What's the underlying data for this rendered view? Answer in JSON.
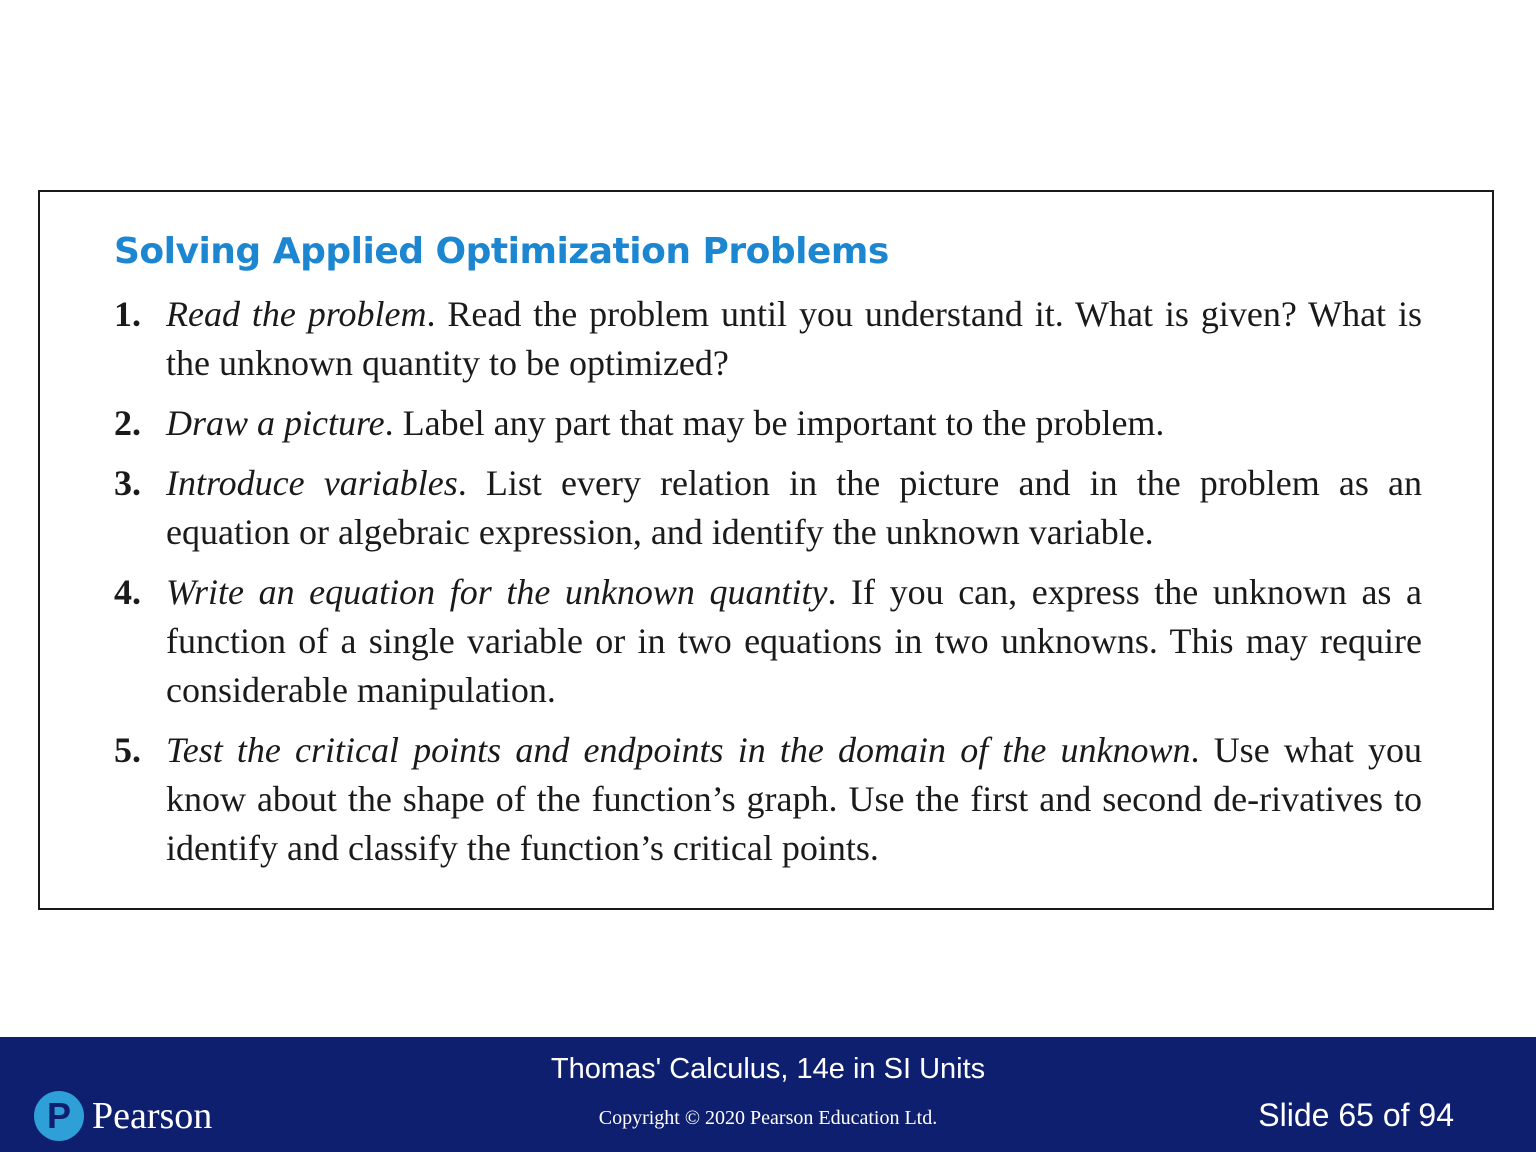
{
  "box": {
    "title": "Solving Applied Optimization Problems",
    "steps": [
      {
        "number": "1.",
        "lead": "Read the problem",
        "text": ". Read the problem until you understand it. What is given? What is the unknown quantity to be optimized?"
      },
      {
        "number": "2.",
        "lead": "Draw a picture",
        "text": ". Label any part that may be important to the problem."
      },
      {
        "number": "3.",
        "lead": "Introduce variables",
        "text": ". List every relation in the picture and in the problem as an equation or algebraic expression, and identify the unknown variable."
      },
      {
        "number": "4.",
        "lead": "Write an equation for the unknown quantity",
        "text": ". If you can, express the unknown as a function of a single variable or in two equations in two unknowns. This may require considerable manipulation."
      },
      {
        "number": "5.",
        "lead": "Test the critical points and endpoints in the domain of the unknown",
        "text": ". Use what you know about the shape of the function’s graph. Use the first and second de-rivatives to identify and classify the function’s critical points."
      }
    ]
  },
  "footer": {
    "logo_mark": "P",
    "logo_text": "Pearson",
    "book_title": "Thomas' Calculus, 14e in SI Units",
    "copyright": "Copyright © 2020 Pearson Education Ltd.",
    "slide_counter": "Slide 65 of 94"
  },
  "colors": {
    "title": "#1c86d1",
    "footer_background": "#0e1f6f",
    "logo_mark": "#2f9fd8"
  }
}
